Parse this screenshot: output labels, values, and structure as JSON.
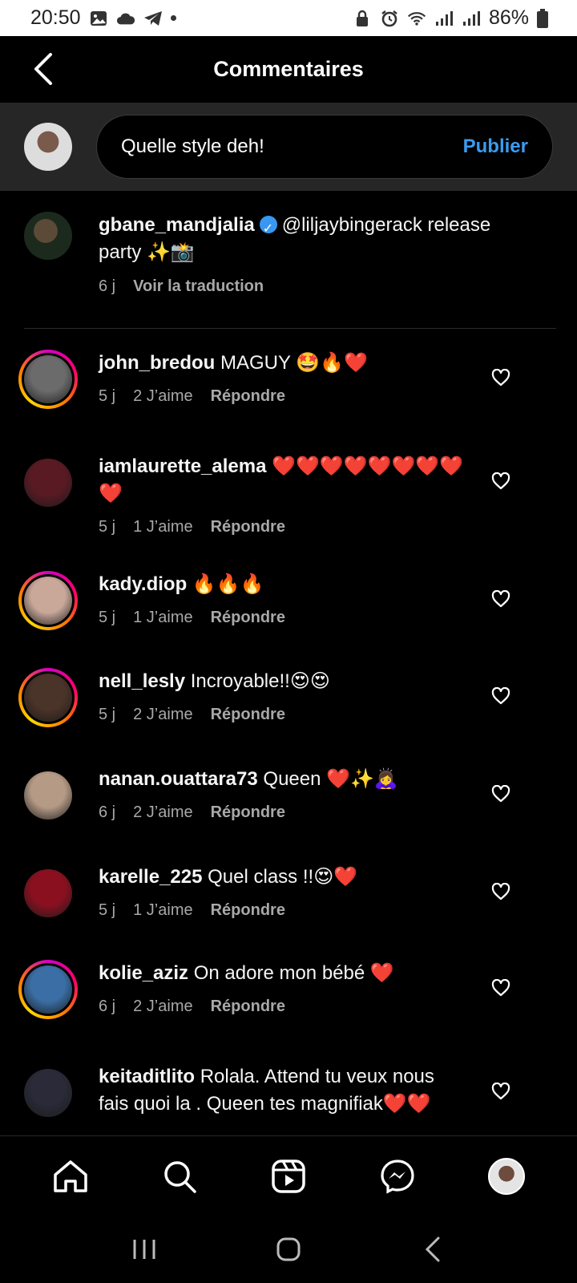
{
  "status_bar": {
    "time": "20:50",
    "battery": "86%",
    "icons_left": [
      "gallery-icon",
      "cloud-icon",
      "telegram-icon",
      "dot-icon"
    ],
    "icons_right": [
      "lock-icon",
      "alarm-icon",
      "wifi-icon",
      "signal-icon",
      "signal-icon",
      "battery-icon"
    ]
  },
  "header": {
    "title": "Commentaires"
  },
  "composer": {
    "value": "Quelle style deh!",
    "publish_label": "Publier"
  },
  "caption": {
    "username": "gbane_mandjalia",
    "verified": true,
    "text": "@liljaybingerack release party ✨📸",
    "time": "6 j",
    "translate_label": "Voir la traduction"
  },
  "comments": [
    {
      "username": "john_bredou",
      "text": "MAGUY 🤩🔥❤️",
      "time": "5 j",
      "likes": "2 J’aime",
      "reply": "Répondre",
      "story": true,
      "avatar_color": "#6b6b6b"
    },
    {
      "username": "iamlaurette_alema",
      "text": "❤️❤️❤️❤️❤️❤️❤️❤️❤️",
      "time": "5 j",
      "likes": "1 J’aime",
      "reply": "Répondre",
      "story": false,
      "avatar_color": "#5a1a24"
    },
    {
      "username": "kady.diop",
      "text": "🔥🔥🔥",
      "time": "5 j",
      "likes": "1 J’aime",
      "reply": "Répondre",
      "story": true,
      "avatar_color": "#c9a89a"
    },
    {
      "username": "nell_lesly",
      "text": "Incroyable!!😍😍",
      "time": "5 j",
      "likes": "2 J’aime",
      "reply": "Répondre",
      "story": true,
      "avatar_color": "#4a3328"
    },
    {
      "username": "nanan.ouattara73",
      "text": "Queen ❤️✨🙇‍♀️",
      "time": "6 j",
      "likes": "2 J’aime",
      "reply": "Répondre",
      "story": false,
      "avatar_color": "#b59a86"
    },
    {
      "username": "karelle_225",
      "text": "Quel class !!😍❤️",
      "time": "5 j",
      "likes": "1 J’aime",
      "reply": "Répondre",
      "story": false,
      "avatar_color": "#8a1020"
    },
    {
      "username": "kolie_aziz",
      "text": "On adore mon bébé ❤️",
      "time": "6 j",
      "likes": "2 J’aime",
      "reply": "Répondre",
      "story": true,
      "avatar_color": "#3a6ea5"
    },
    {
      "username": "keitaditlito",
      "text": "Rolala. Attend tu veux nous fais quoi la . Queen tes magnifiak❤️❤️",
      "time": "",
      "likes": "",
      "reply": "",
      "story": false,
      "avatar_color": "#2a2a38"
    }
  ],
  "bottom_nav": [
    "home-icon",
    "search-icon",
    "reels-icon",
    "messenger-icon",
    "profile-avatar"
  ],
  "system_nav": [
    "recent-apps-icon",
    "home-button-icon",
    "back-icon"
  ],
  "colors": {
    "background": "#000000",
    "accent_blue": "#3b9cf0",
    "secondary_text": "#a8a8a8",
    "composer_bg": "#262626"
  }
}
